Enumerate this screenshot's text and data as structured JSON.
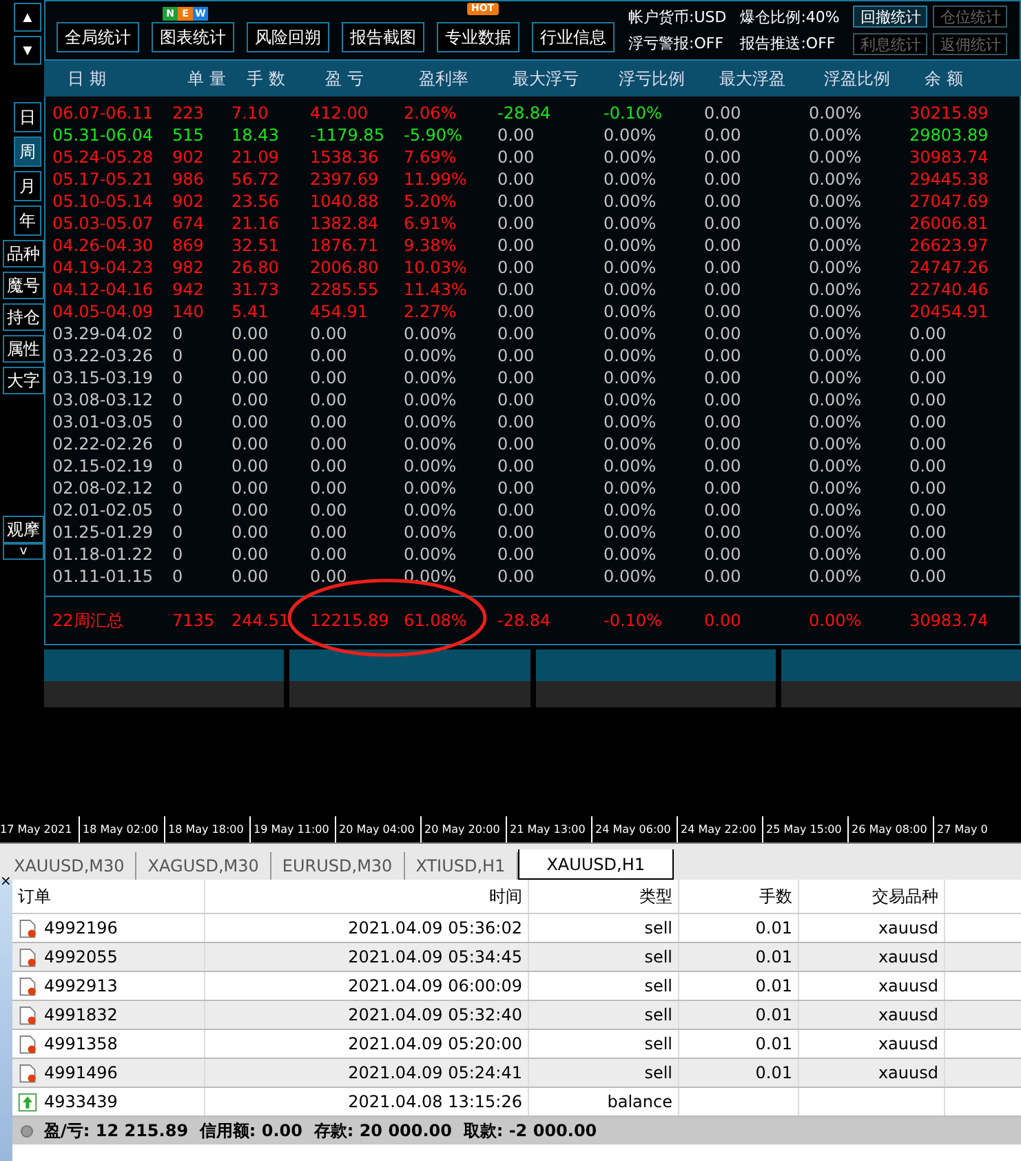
{
  "nav_arrows": [
    "▲",
    "▼"
  ],
  "toolbar": {
    "buttons": [
      {
        "label": "全局统计",
        "kind": "plain"
      },
      {
        "label": "图表统计",
        "kind": "new",
        "badge_letters": [
          "N",
          "E",
          "W"
        ]
      },
      {
        "label": "风险回朔",
        "kind": "plain"
      },
      {
        "label": "报告截图",
        "kind": "plain"
      },
      {
        "label": "专业数据",
        "kind": "hot",
        "badge_text": "HOT"
      },
      {
        "label": "行业信息",
        "kind": "plain"
      }
    ],
    "info": [
      "帐户货币:USD",
      "爆仓比例:40%",
      "浮亏警报:OFF",
      "报告推送:OFF"
    ],
    "small_buttons": [
      {
        "label": "回撤统计",
        "disabled": false
      },
      {
        "label": "仓位统计",
        "disabled": true
      },
      {
        "label": "利息统计",
        "disabled": true
      },
      {
        "label": "返佣统计",
        "disabled": true
      }
    ]
  },
  "sidebar": {
    "items": [
      {
        "label": "日",
        "selected": false,
        "kind": "narrow"
      },
      {
        "label": "周",
        "selected": true,
        "kind": "narrow"
      },
      {
        "label": "月",
        "selected": false,
        "kind": "narrow"
      },
      {
        "label": "年",
        "selected": false,
        "kind": "narrow"
      },
      {
        "label": "品种",
        "selected": false,
        "kind": "wide"
      },
      {
        "label": "魔号",
        "selected": false,
        "kind": "wide"
      },
      {
        "label": "持仓",
        "selected": false,
        "kind": "wide"
      },
      {
        "label": "属性",
        "selected": false,
        "kind": "wide"
      },
      {
        "label": "大字",
        "selected": false,
        "kind": "wide"
      }
    ],
    "bottom_items": [
      "观摩",
      "v"
    ]
  },
  "table": {
    "columns": [
      "日 期",
      "单 量",
      "手 数",
      "盈 亏",
      "盈利率",
      "最大浮亏",
      "浮亏比例",
      "最大浮盈",
      "浮盈比例",
      "余 额"
    ],
    "rows": [
      {
        "kind": "gain",
        "float_alert": true,
        "cells": [
          "06.07-06.11",
          "223",
          "7.10",
          "412.00",
          "2.06%",
          "-28.84",
          "-0.10%",
          "0.00",
          "0.00%",
          "30215.89"
        ]
      },
      {
        "kind": "loss",
        "float_alert": false,
        "cells": [
          "05.31-06.04",
          "515",
          "18.43",
          "-1179.85",
          "-5.90%",
          "0.00",
          "0.00%",
          "0.00",
          "0.00%",
          "29803.89"
        ]
      },
      {
        "kind": "gain",
        "float_alert": false,
        "cells": [
          "05.24-05.28",
          "902",
          "21.09",
          "1538.36",
          "7.69%",
          "0.00",
          "0.00%",
          "0.00",
          "0.00%",
          "30983.74"
        ]
      },
      {
        "kind": "gain",
        "float_alert": false,
        "cells": [
          "05.17-05.21",
          "986",
          "56.72",
          "2397.69",
          "11.99%",
          "0.00",
          "0.00%",
          "0.00",
          "0.00%",
          "29445.38"
        ]
      },
      {
        "kind": "gain",
        "float_alert": false,
        "cells": [
          "05.10-05.14",
          "902",
          "23.56",
          "1040.88",
          "5.20%",
          "0.00",
          "0.00%",
          "0.00",
          "0.00%",
          "27047.69"
        ]
      },
      {
        "kind": "gain",
        "float_alert": false,
        "cells": [
          "05.03-05.07",
          "674",
          "21.16",
          "1382.84",
          "6.91%",
          "0.00",
          "0.00%",
          "0.00",
          "0.00%",
          "26006.81"
        ]
      },
      {
        "kind": "gain",
        "float_alert": false,
        "cells": [
          "04.26-04.30",
          "869",
          "32.51",
          "1876.71",
          "9.38%",
          "0.00",
          "0.00%",
          "0.00",
          "0.00%",
          "26623.97"
        ]
      },
      {
        "kind": "gain",
        "float_alert": false,
        "cells": [
          "04.19-04.23",
          "982",
          "26.80",
          "2006.80",
          "10.03%",
          "0.00",
          "0.00%",
          "0.00",
          "0.00%",
          "24747.26"
        ]
      },
      {
        "kind": "gain",
        "float_alert": false,
        "cells": [
          "04.12-04.16",
          "942",
          "31.73",
          "2285.55",
          "11.43%",
          "0.00",
          "0.00%",
          "0.00",
          "0.00%",
          "22740.46"
        ]
      },
      {
        "kind": "gain",
        "float_alert": false,
        "cells": [
          "04.05-04.09",
          "140",
          "5.41",
          "454.91",
          "2.27%",
          "0.00",
          "0.00%",
          "0.00",
          "0.00%",
          "20454.91"
        ]
      },
      {
        "kind": "flat",
        "float_alert": false,
        "cells": [
          "03.29-04.02",
          "0",
          "0.00",
          "0.00",
          "0.00%",
          "0.00",
          "0.00%",
          "0.00",
          "0.00%",
          "0.00"
        ]
      },
      {
        "kind": "flat",
        "float_alert": false,
        "cells": [
          "03.22-03.26",
          "0",
          "0.00",
          "0.00",
          "0.00%",
          "0.00",
          "0.00%",
          "0.00",
          "0.00%",
          "0.00"
        ]
      },
      {
        "kind": "flat",
        "float_alert": false,
        "cells": [
          "03.15-03.19",
          "0",
          "0.00",
          "0.00",
          "0.00%",
          "0.00",
          "0.00%",
          "0.00",
          "0.00%",
          "0.00"
        ]
      },
      {
        "kind": "flat",
        "float_alert": false,
        "cells": [
          "03.08-03.12",
          "0",
          "0.00",
          "0.00",
          "0.00%",
          "0.00",
          "0.00%",
          "0.00",
          "0.00%",
          "0.00"
        ]
      },
      {
        "kind": "flat",
        "float_alert": false,
        "cells": [
          "03.01-03.05",
          "0",
          "0.00",
          "0.00",
          "0.00%",
          "0.00",
          "0.00%",
          "0.00",
          "0.00%",
          "0.00"
        ]
      },
      {
        "kind": "flat",
        "float_alert": false,
        "cells": [
          "02.22-02.26",
          "0",
          "0.00",
          "0.00",
          "0.00%",
          "0.00",
          "0.00%",
          "0.00",
          "0.00%",
          "0.00"
        ]
      },
      {
        "kind": "flat",
        "float_alert": false,
        "cells": [
          "02.15-02.19",
          "0",
          "0.00",
          "0.00",
          "0.00%",
          "0.00",
          "0.00%",
          "0.00",
          "0.00%",
          "0.00"
        ]
      },
      {
        "kind": "flat",
        "float_alert": false,
        "cells": [
          "02.08-02.12",
          "0",
          "0.00",
          "0.00",
          "0.00%",
          "0.00",
          "0.00%",
          "0.00",
          "0.00%",
          "0.00"
        ]
      },
      {
        "kind": "flat",
        "float_alert": false,
        "cells": [
          "02.01-02.05",
          "0",
          "0.00",
          "0.00",
          "0.00%",
          "0.00",
          "0.00%",
          "0.00",
          "0.00%",
          "0.00"
        ]
      },
      {
        "kind": "flat",
        "float_alert": false,
        "cells": [
          "01.25-01.29",
          "0",
          "0.00",
          "0.00",
          "0.00%",
          "0.00",
          "0.00%",
          "0.00",
          "0.00%",
          "0.00"
        ]
      },
      {
        "kind": "flat",
        "float_alert": false,
        "cells": [
          "01.18-01.22",
          "0",
          "0.00",
          "0.00",
          "0.00%",
          "0.00",
          "0.00%",
          "0.00",
          "0.00%",
          "0.00"
        ]
      },
      {
        "kind": "flat",
        "float_alert": false,
        "cells": [
          "01.11-01.15",
          "0",
          "0.00",
          "0.00",
          "0.00%",
          "0.00",
          "0.00%",
          "0.00",
          "0.00%",
          "0.00"
        ]
      }
    ],
    "summary": [
      "22周汇总",
      "7135",
      "244.51",
      "12215.89",
      "61.08%",
      "-28.84",
      "-0.10%",
      "0.00",
      "0.00%",
      "30983.74"
    ]
  },
  "timeline": [
    "17 May 2021",
    "18 May 02:00",
    "18 May 18:00",
    "19 May 11:00",
    "20 May 04:00",
    "20 May 20:00",
    "21 May 13:00",
    "24 May 06:00",
    "24 May 22:00",
    "25 May 15:00",
    "26 May 08:00",
    "27 May 0"
  ],
  "chart_tabs": [
    {
      "label": "XAUUSD,M30",
      "selected": false
    },
    {
      "label": "XAGUSD,M30",
      "selected": false
    },
    {
      "label": "EURUSD,M30",
      "selected": false
    },
    {
      "label": "XTIUSD,H1",
      "selected": false
    },
    {
      "label": "XAUUSD,H1",
      "selected": true
    }
  ],
  "orders": {
    "close_glyph": "×",
    "columns": [
      "订单",
      "时间",
      "类型",
      "手数",
      "交易品种"
    ],
    "rows": [
      {
        "kind": "sell",
        "cells": [
          "4992196",
          "2021.04.09 05:36:02",
          "sell",
          "0.01",
          "xauusd"
        ]
      },
      {
        "kind": "sell",
        "cells": [
          "4992055",
          "2021.04.09 05:34:45",
          "sell",
          "0.01",
          "xauusd"
        ]
      },
      {
        "kind": "sell",
        "cells": [
          "4992913",
          "2021.04.09 06:00:09",
          "sell",
          "0.01",
          "xauusd"
        ]
      },
      {
        "kind": "sell",
        "cells": [
          "4991832",
          "2021.04.09 05:32:40",
          "sell",
          "0.01",
          "xauusd"
        ]
      },
      {
        "kind": "sell",
        "cells": [
          "4991358",
          "2021.04.09 05:20:00",
          "sell",
          "0.01",
          "xauusd"
        ]
      },
      {
        "kind": "sell",
        "cells": [
          "4991496",
          "2021.04.09 05:24:41",
          "sell",
          "0.01",
          "xauusd"
        ]
      },
      {
        "kind": "balance",
        "cells": [
          "4933439",
          "2021.04.08 13:15:26",
          "balance",
          "",
          ""
        ]
      }
    ],
    "footer": "盈/亏: 12 215.89  信用额: 0.00  存款: 20 000.00  取款: -2 000.00"
  }
}
